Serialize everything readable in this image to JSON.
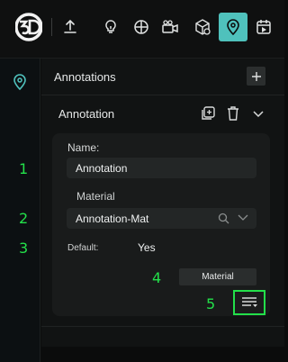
{
  "toolbar": {
    "logo_icon": "3d-logo-icon",
    "icons": [
      "upload-icon",
      "bulb-icon",
      "globe-grid-icon",
      "camera-icon",
      "box-icon",
      "location-pin-icon",
      "media-card-icon"
    ],
    "active_icon": "location-pin-icon",
    "accent_color": "#4fc1bc"
  },
  "panel": {
    "section_title": "Annotations",
    "item_title": "Annotation",
    "name_label": "Name:",
    "name_value": "Annotation",
    "material_label": "Material",
    "material_value": "Annotation-Mat",
    "default_label": "Default:",
    "default_value": "Yes",
    "material_button": "Material"
  },
  "callouts": [
    "1",
    "2",
    "3",
    "4",
    "5"
  ],
  "callout_color": "#23e04a"
}
